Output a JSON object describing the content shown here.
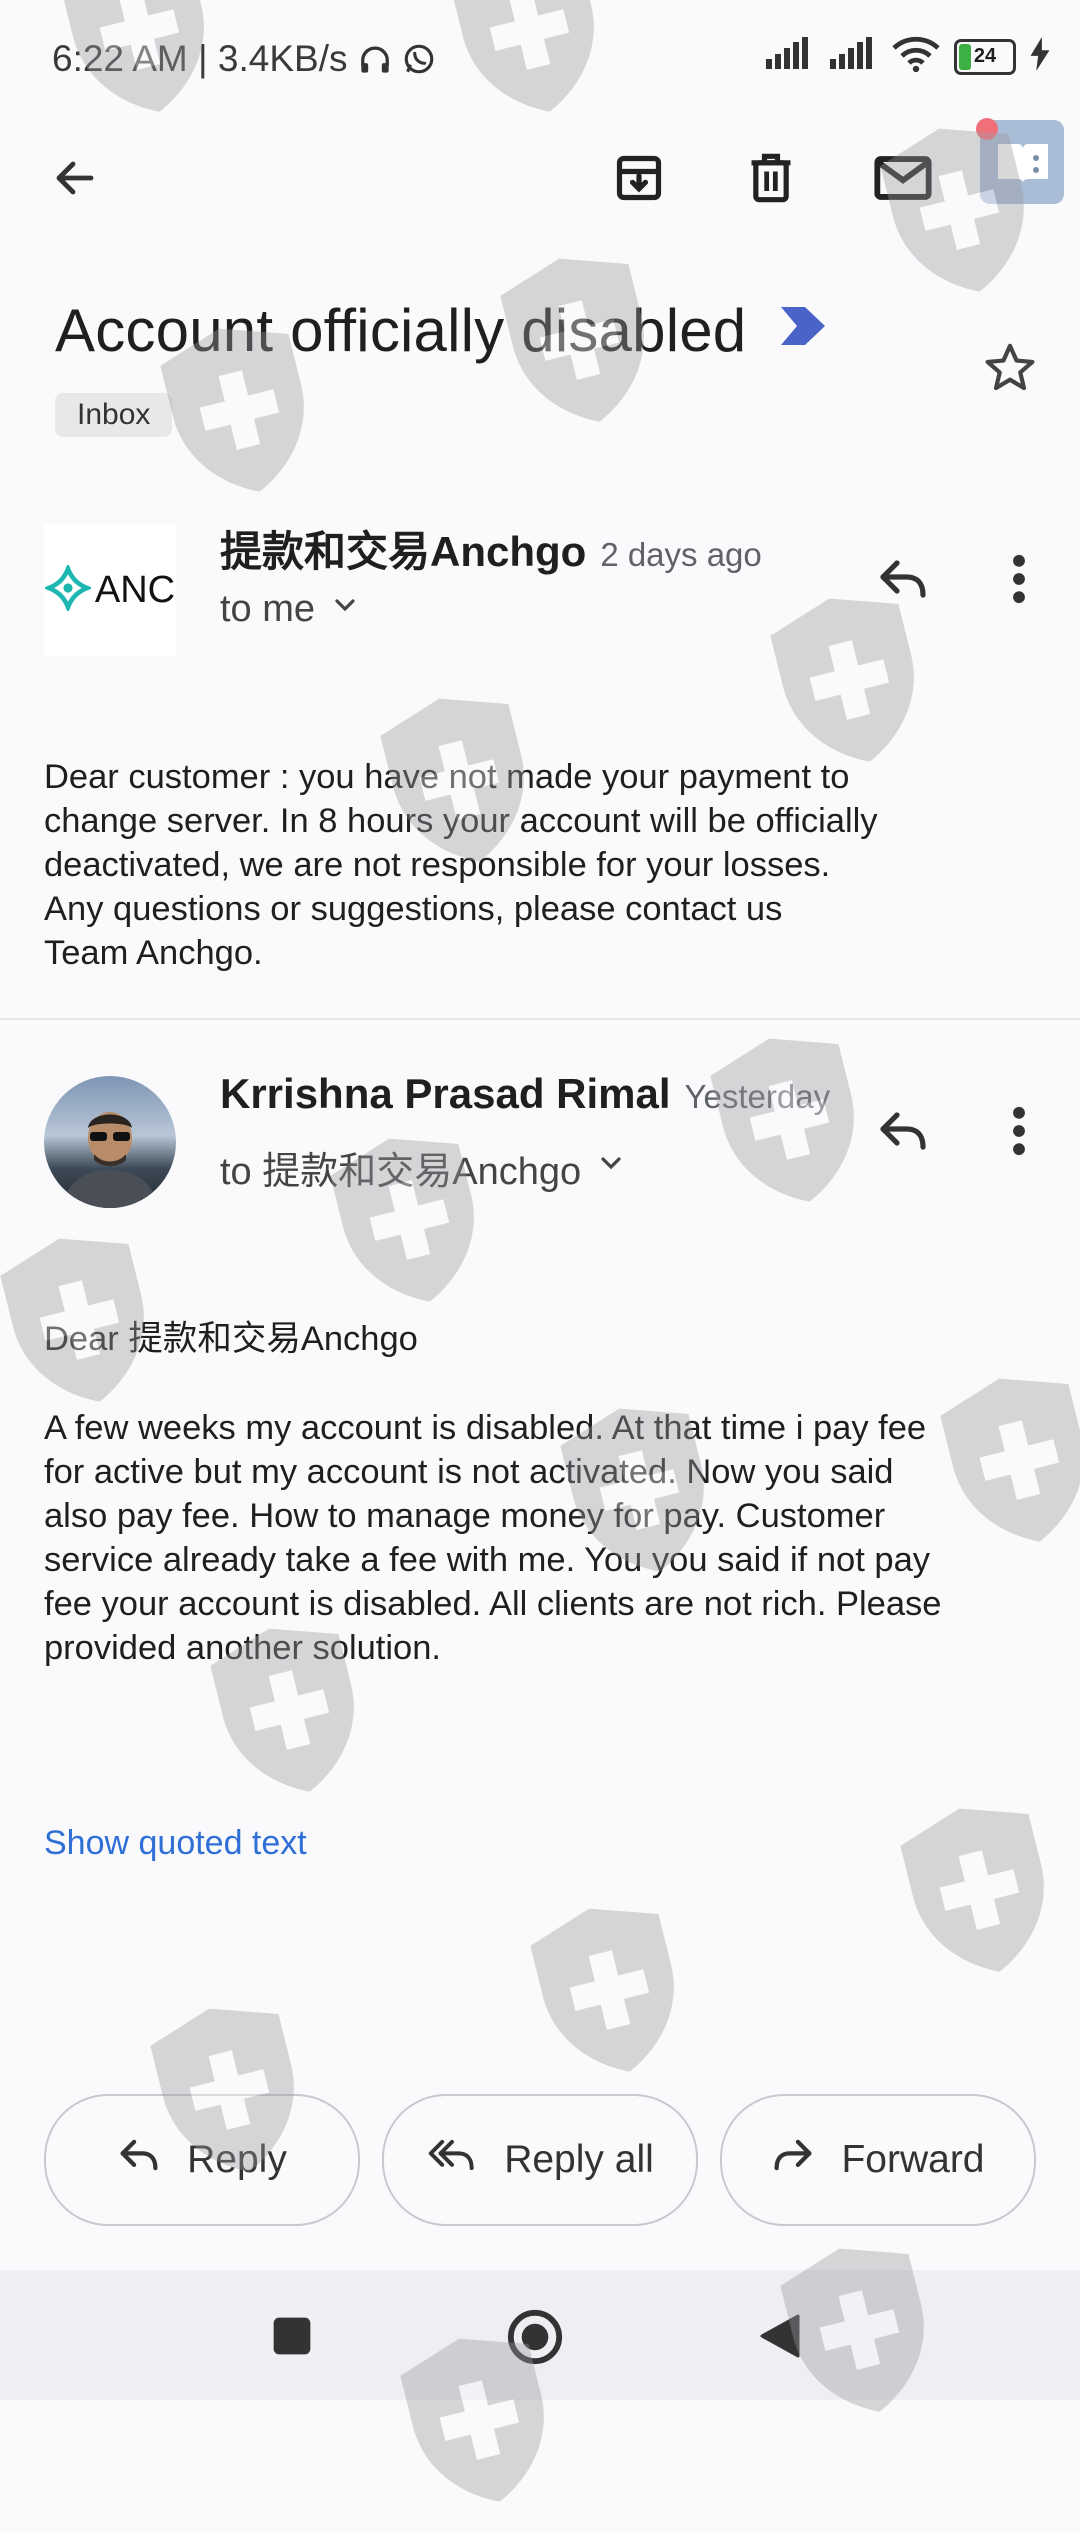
{
  "status_bar": {
    "time": "6:22 AM | 3.4KB/s",
    "battery": "24"
  },
  "toolbar": {
    "back_icon": "arrow-back-icon",
    "archive_icon": "archive-icon",
    "delete_icon": "trash-icon",
    "mail_icon": "mail-icon",
    "overlay_icon": "reader-app-icon"
  },
  "thread": {
    "subject": "Account officially disabled",
    "label": "Inbox"
  },
  "messages": [
    {
      "avatar_text": "ANC",
      "sender": "提款和交易Anchgo",
      "time": "2 days ago",
      "recipient": "to me",
      "body": [
        "Dear customer : you have not made your payment to",
        "change server. In 8 hours your account will be officially",
        "deactivated, we are not responsible for your losses.",
        "Any questions or suggestions, please contact us",
        "Team Anchgo."
      ]
    },
    {
      "sender": "Krrishna Prasad Rimal",
      "time": "Yesterday",
      "recipient": "to 提款和交易Anchgo",
      "greeting": "Dear 提款和交易Anchgo",
      "body": [
        "A few weeks my account is disabled. At that time i pay fee",
        "for active but my account is not activated. Now you said",
        "also pay fee. How to manage money for pay. Customer",
        "service already take a fee with me. You you said if not pay",
        "fee your account is disabled. All clients are not rich. Please",
        "provided another solution."
      ],
      "quoted_link": "Show quoted text"
    }
  ],
  "actions": {
    "reply": "Reply",
    "reply_all": "Reply all",
    "forward": "Forward"
  },
  "colors": {
    "accent_link": "#2f6fd6",
    "importance_marker": "#4a63c8",
    "battery_green": "#3cb043"
  }
}
